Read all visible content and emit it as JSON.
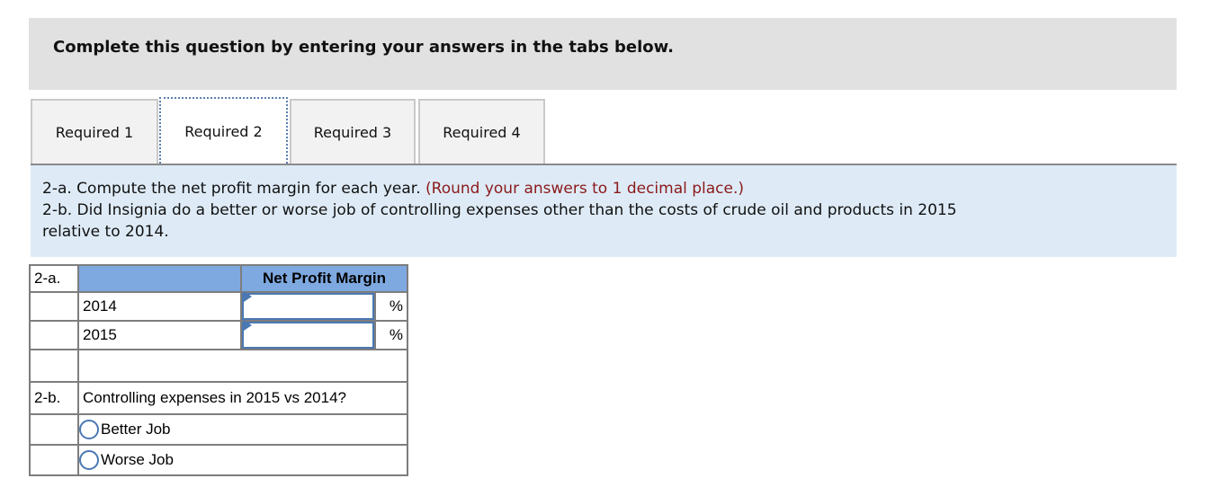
{
  "banner": {
    "text": "Complete this question by entering your answers in the tabs below."
  },
  "tabs": [
    {
      "label": "Required 1",
      "active": false
    },
    {
      "label": "Required 2",
      "active": true
    },
    {
      "label": "Required 3",
      "active": false
    },
    {
      "label": "Required 4",
      "active": false
    }
  ],
  "instructions": {
    "line1_main": "2-a. Compute the net profit margin for each year. ",
    "line1_note": "(Round your answers to 1 decimal place.)",
    "line2": "2-b. Did Insignia do a better or worse job of controlling expenses other than the costs of crude oil and products in 2015",
    "line3": "relative to 2014."
  },
  "part_a": {
    "label": "2-a.",
    "column_header": "Net Profit Margin",
    "rows": [
      {
        "year": "2014",
        "value": "",
        "unit": "%"
      },
      {
        "year": "2015",
        "value": "",
        "unit": "%"
      }
    ]
  },
  "part_b": {
    "label": "2-b.",
    "question": "Controlling expenses in 2015 vs 2014?",
    "options": [
      "Better Job",
      "Worse Job"
    ]
  },
  "colors": {
    "header_blue": "#7ea9e0",
    "instruction_bg": "#deebf7",
    "note_red": "#8b1a1a",
    "banner_gray": "#e1e1e1"
  }
}
